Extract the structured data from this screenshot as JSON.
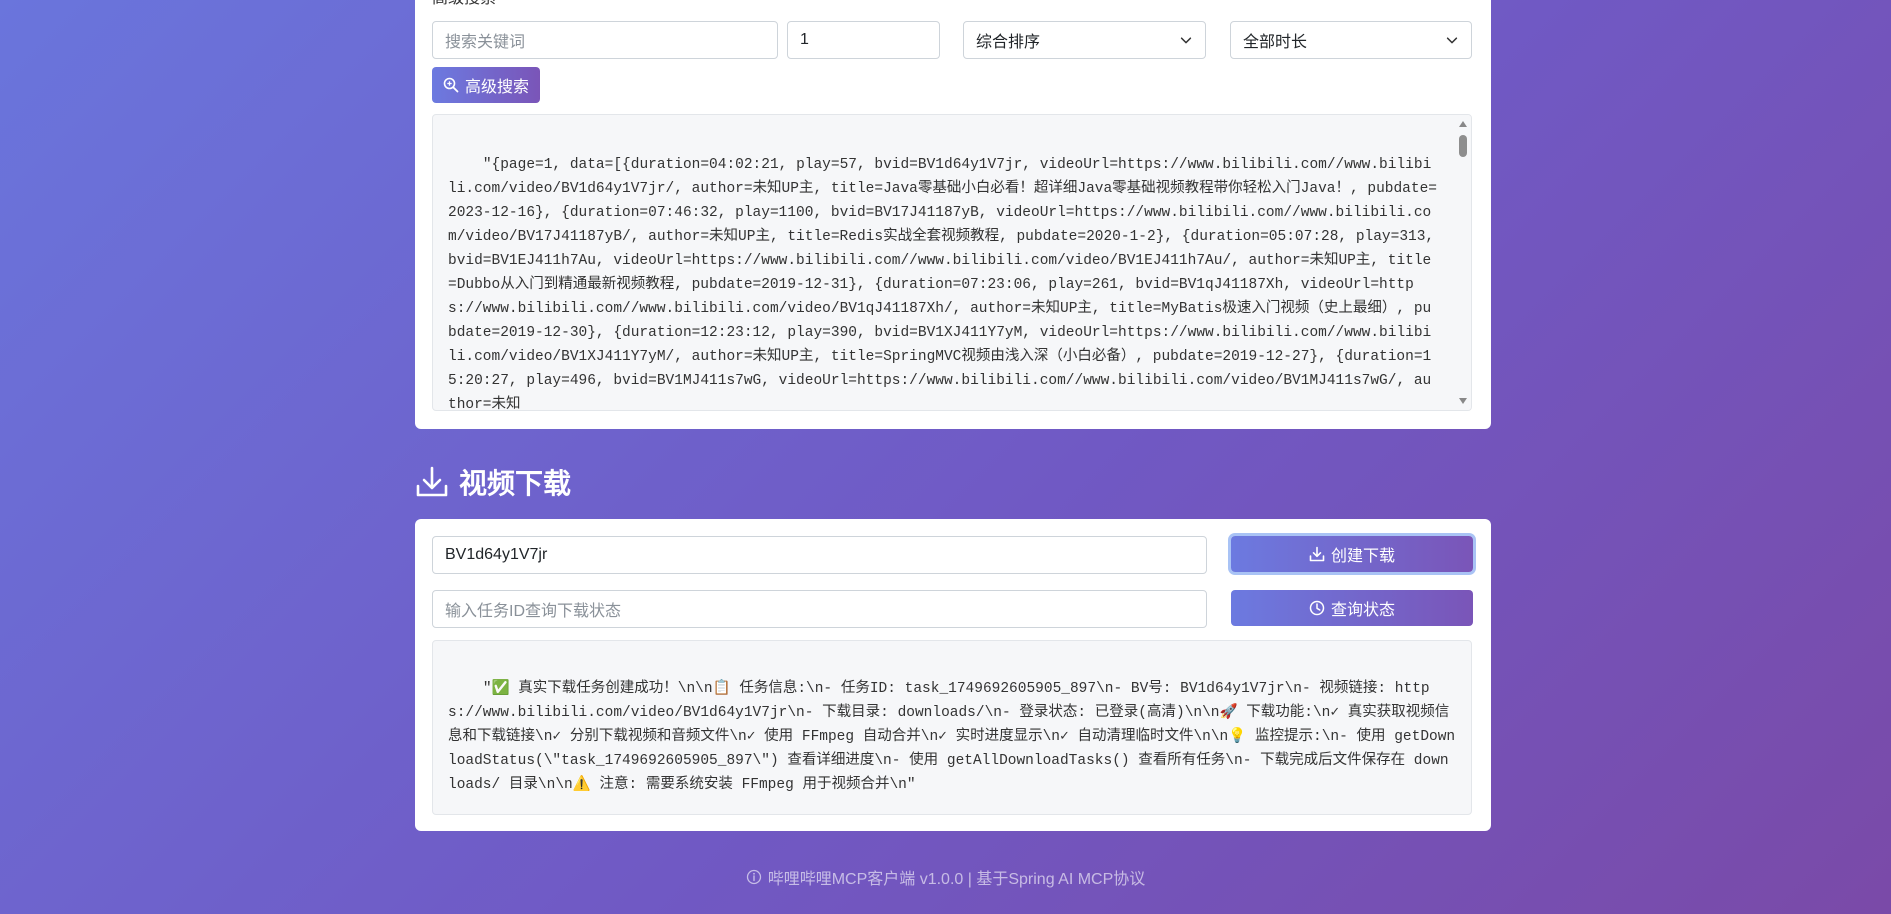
{
  "search": {
    "section_label": "高级搜索",
    "keyword_placeholder": "搜索关键词",
    "page_value": "1",
    "sort_select": "综合排序",
    "duration_select": "全部时长",
    "button_label": "高级搜索",
    "output": "\"{page=1, data=[{duration=04:02:21, play=57, bvid=BV1d64y1V7jr, videoUrl=https://www.bilibili.com//www.bilibili.com/video/BV1d64y1V7jr/, author=未知UP主, title=Java零基础小白必看！超详细Java零基础视频教程带你轻松入门Java！, pubdate=2023-12-16}, {duration=07:46:32, play=1100, bvid=BV17J41187yB, videoUrl=https://www.bilibili.com//www.bilibili.com/video/BV17J41187yB/, author=未知UP主, title=Redis实战全套视频教程, pubdate=2020-1-2}, {duration=05:07:28, play=313, bvid=BV1EJ411h7Au, videoUrl=https://www.bilibili.com//www.bilibili.com/video/BV1EJ411h7Au/, author=未知UP主, title=Dubbo从入门到精通最新视频教程, pubdate=2019-12-31}, {duration=07:23:06, play=261, bvid=BV1qJ41187Xh, videoUrl=https://www.bilibili.com//www.bilibili.com/video/BV1qJ41187Xh/, author=未知UP主, title=MyBatis极速入门视频（史上最细）, pubdate=2019-12-30}, {duration=12:23:12, play=390, bvid=BV1XJ411Y7yM, videoUrl=https://www.bilibili.com//www.bilibili.com/video/BV1XJ411Y7yM/, author=未知UP主, title=SpringMVC视频由浅入深（小白必备）, pubdate=2019-12-27}, {duration=15:20:27, play=496, bvid=BV1MJ411s7wG, videoUrl=https://www.bilibili.com//www.bilibili.com/video/BV1MJ411s7wG/, author=未知"
  },
  "download": {
    "title": "视频下载",
    "bvid_value": "BV1d64y1V7jr",
    "create_button": "创建下载",
    "task_placeholder": "输入任务ID查询下载状态",
    "query_button": "查询状态",
    "output": "\"✅ 真实下载任务创建成功！\\n\\n📋 任务信息:\\n- 任务ID: task_1749692605905_897\\n- BV号: BV1d64y1V7jr\\n- 视频链接: https://www.bilibili.com/video/BV1d64y1V7jr\\n- 下载目录: downloads/\\n- 登录状态: 已登录(高清)\\n\\n🚀 下载功能:\\n✓ 真实获取视频信息和下载链接\\n✓ 分别下载视频和音频文件\\n✓ 使用 FFmpeg 自动合并\\n✓ 实时进度显示\\n✓ 自动清理临时文件\\n\\n💡 监控提示:\\n- 使用 getDownloadStatus(\\\"task_1749692605905_897\\\") 查看详细进度\\n- 使用 getAllDownloadTasks() 查看所有任务\\n- 下载完成后文件保存在 downloads/ 目录\\n\\n⚠️ 注意: 需要系统安装 FFmpeg 用于视频合并\\n\""
  },
  "footer": {
    "text": "哔哩哔哩MCP客户端 v1.0.0 | 基于Spring AI MCP协议"
  }
}
